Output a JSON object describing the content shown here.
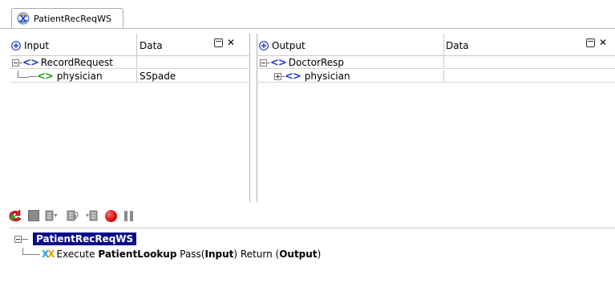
{
  "tab": {
    "label": "PatientRecReqWS",
    "icon": "service-icon"
  },
  "input_pane": {
    "col1": "Input",
    "col2": "Data",
    "rows": [
      {
        "name": "RecordRequest",
        "value": "",
        "expanded": true
      },
      {
        "name": "physician",
        "value": "SSpade"
      }
    ]
  },
  "output_pane": {
    "col1": "Output",
    "col2": "Data",
    "rows": [
      {
        "name": "DoctorResp",
        "value": "",
        "expanded": true
      },
      {
        "name": "physician",
        "value": "",
        "expanded": false
      }
    ]
  },
  "toolbar": {
    "icons": [
      "run-icon",
      "stop-icon",
      "step-into-icon",
      "step-over-icon",
      "step-out-icon",
      "record-icon",
      "pause-icon"
    ]
  },
  "log": {
    "root": "PatientRecReqWS",
    "line": {
      "prefix": "Execute ",
      "service": "PatientLookup",
      "pass_text": " Pass(",
      "pass_arg": "Input",
      "return_text": ") Return (",
      "return_arg": "Output",
      "suffix": ")"
    }
  },
  "colors": {
    "tag_blue": "#1c3cd4",
    "tag_green": "#1fa21f",
    "selection": "#0a0a8a",
    "record_red": "#c80000"
  }
}
